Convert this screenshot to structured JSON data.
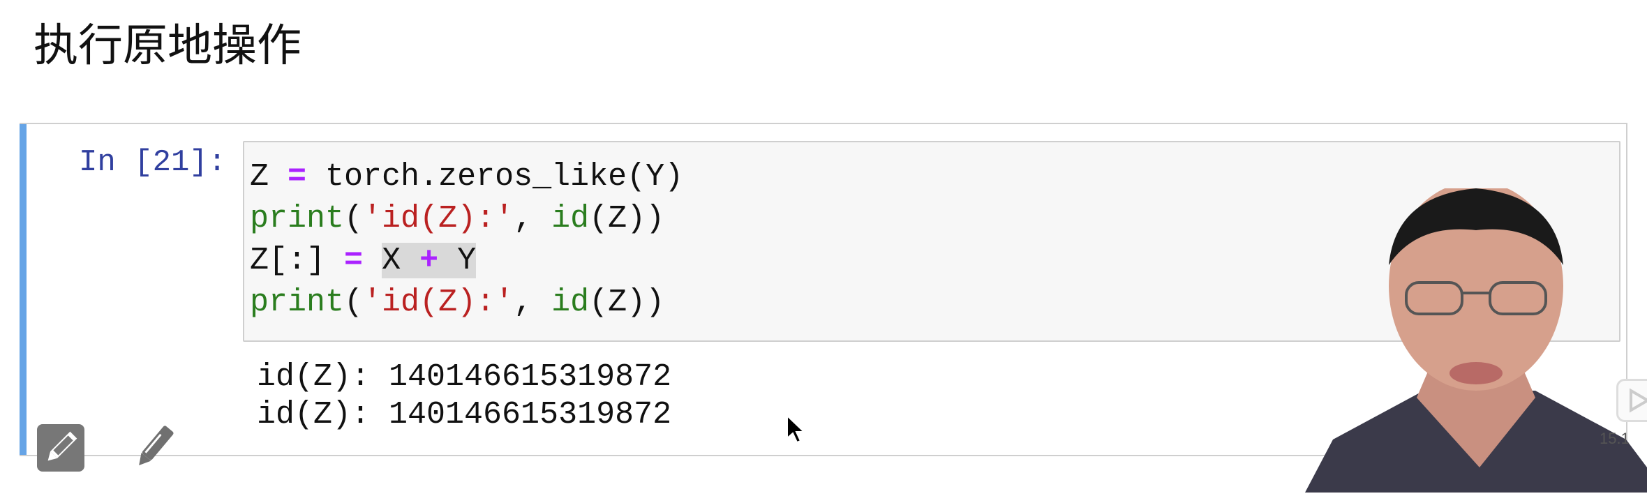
{
  "section_title": "执行原地操作",
  "cell": {
    "prompt": "In [21]:",
    "code_lines": [
      {
        "plain_a": "Z ",
        "op": "=",
        "plain_b": " torch.zeros_like(Y)"
      },
      {
        "kw": "print",
        "p1": "(",
        "str": "'id(Z):'",
        "p2": ", ",
        "kw2": "id",
        "p3": "(Z))"
      },
      {
        "plain_a": "Z[:] ",
        "op": "=",
        "sel_a": "X ",
        "op2": "+",
        "sel_b": " Y"
      },
      {
        "kw": "print",
        "p1": "(",
        "str": "'id(Z):'",
        "p2": ", ",
        "kw2": "id",
        "p3": "(Z))"
      }
    ],
    "output_lines": [
      "id(Z): 140146615319872",
      "id(Z): 140146615319872"
    ]
  },
  "overlay": {
    "version_text": "15.1"
  },
  "icons": [
    "edit-pencil-box-icon",
    "pencil-icon",
    "mouse-cursor-icon",
    "play-icon"
  ],
  "colors": {
    "cell_accent": "#66a4e6",
    "prompt": "#303f9f",
    "keyword": "#2a7d1e",
    "string": "#ba2121",
    "operator": "#aa22ff"
  }
}
